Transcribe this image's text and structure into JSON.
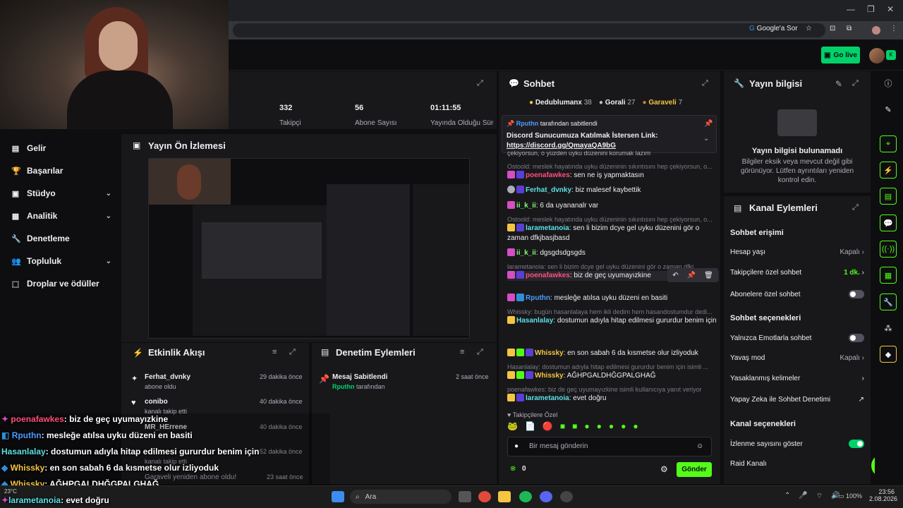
{
  "browser": {
    "google_ask": "Google'a Sor"
  },
  "header": {
    "go_live": "Go live"
  },
  "stats": [
    {
      "value": "332",
      "label": "Takipçi"
    },
    {
      "value": "56",
      "label": "Abone Sayısı"
    },
    {
      "value": "01:11:55",
      "label": "Yayında Olduğu Süre"
    }
  ],
  "nav": [
    {
      "label": "Gelir"
    },
    {
      "label": "Başarılar"
    },
    {
      "label": "Stüdyo"
    },
    {
      "label": "Analitik"
    },
    {
      "label": "Denetleme"
    },
    {
      "label": "Topluluk"
    },
    {
      "label": "Droplar ve ödüller"
    }
  ],
  "preview": {
    "title": "Yayın Ön İzlemesi"
  },
  "activity": {
    "title": "Etkinlik Akışı",
    "items": [
      {
        "name": "Ferhat_dvnky",
        "desc": "abone oldu",
        "time": "29 dakika önce"
      },
      {
        "name": "conibo",
        "desc": "kanalı takip etti",
        "time": "40 dakika önce"
      },
      {
        "name": "MR_HErrene",
        "desc": "",
        "time": "40 dakika önce"
      },
      {
        "name": "",
        "desc": "",
        "time": "52 dakika önce"
      },
      {
        "name": "",
        "desc": "kanalı takip etti",
        "time": ""
      },
      {
        "name": "Garaveli",
        "desc": "Garaveli yeniden abone oldu!",
        "time": "23 saat önce"
      }
    ]
  },
  "mod": {
    "title": "Denetim Eylemleri",
    "items": [
      {
        "action": "Mesaj Sabitlendi",
        "by": "Rputhn",
        "by_suffix": "tarafından",
        "time": "2 saat önce"
      }
    ]
  },
  "chat": {
    "title": "Sohbet",
    "leaders": [
      {
        "name": "Dedublumanx",
        "count": "38"
      },
      {
        "name": "Gorali",
        "count": "27"
      },
      {
        "name": "Garaveli",
        "count": "7"
      }
    ],
    "pinned": {
      "by": "Rputhn",
      "by_suffix": "tarafından sabitlendi",
      "text": "Discord Sunucumuza Katılmak İstersen Link:",
      "link": "https://discord.gg/QmayaQA9bG"
    },
    "partial": "çekiyorsun, o yüzden uyku düzenini korumak lazım",
    "messages": [
      {
        "reply": "Ostoold: meslek hayatında uyku düzeninin sıkıntısını hep çekiyorsun, o...",
        "user": "poenafawkes",
        "color": "#ff4f7b",
        "text": "sen ne iş yapmaktasın"
      },
      {
        "reply": "",
        "user": "Ferhat_dvnky",
        "color": "#5ce1e6",
        "text": "biz malesef kaybettik"
      },
      {
        "reply": "",
        "user": "ii_k_ii",
        "color": "#7cff6b",
        "text": "6 da uyananalr var"
      },
      {
        "reply": "Ostoold: meslek hayatında uyku düzeninin sıkıntısını hep çekiyorsun, o...",
        "user": "larametanoia",
        "color": "#5ce1e6",
        "text": "sen li bizim dcye gel uyku düzenini gör o zaman dfkjbasjbasd"
      },
      {
        "reply": "",
        "user": "ii_k_ii",
        "color": "#7cff6b",
        "text": "dgsgdsdgsgds"
      },
      {
        "reply": "larametanoia: sen li bizim dcye gel uyku düzenini gör o zaman dfkj...",
        "user": "poenafawkes",
        "color": "#ff4f7b",
        "text": "biz de geç uyumayızkine"
      },
      {
        "reply": "",
        "user": "Rputhn",
        "color": "#4f9bff",
        "text": "mesleğe atılsa uyku düzeni en basiti"
      },
      {
        "reply": "Whissky: bugün hasanlalaya hem ikli dedim hem hasandostumdur dedi...",
        "user": "Hasanlalay",
        "color": "#5ce1e6",
        "text": "dostumun adıyla hitap edilmesi gururdur benim için"
      },
      {
        "reply": "",
        "user": "Whissky",
        "color": "#f5c542",
        "text": "en son sabah 6 da kısmetse olur izliyoduk"
      },
      {
        "reply": "Hasanlalay: dostumun adıyla hitap edilmesi gururdur benim için isimli ...",
        "user": "Whissky",
        "color": "#f5c542",
        "text": "AĞHPGALDHĞGPALGHAĞ"
      },
      {
        "reply": "poenafawkes: biz de geç uyumayızkine isimli kullanıcıya yanıt veriyor",
        "user": "larametanoia",
        "color": "#5ce1e6",
        "text": "evet doğru"
      }
    ],
    "followers_only": "Takipçilere Özel",
    "input_placeholder": "Bir mesaj gönderin",
    "points": "0",
    "send": "Gönder"
  },
  "info": {
    "title": "Yayın bilgisi",
    "empty_title": "Yayın bilgisi bulunamadı",
    "empty_desc": "Bilgiler eksik veya mevcut değil gibi görünüyor. Lütfen ayrıntıları yeniden kontrol edin."
  },
  "channel": {
    "title": "Kanal Eylemleri",
    "chat_access": "Sohbet erişimi",
    "account_age": "Hesap yaşı",
    "account_age_val": "Kapalı",
    "followers_chat": "Takipçilere özel sohbet",
    "followers_chat_val": "1 dk.",
    "subs_chat": "Abonelere özel sohbet",
    "chat_options": "Sohbet seçenekleri",
    "emote_only": "Yalnızca Emotlarla sohbet",
    "slow_mode": "Yavaş mod",
    "slow_mode_val": "Kapalı",
    "banned_words": "Yasaklanmış kelimeler",
    "ai_mod": "Yapay Zeka ile Sohbet Denetimi",
    "channel_options": "Kanal seçenekleri",
    "show_viewers": "İzlenme sayısını göster",
    "raid": "Raid Kanalı"
  },
  "overlay": [
    {
      "user": "poenafawkes",
      "color": "#ff4f7b",
      "text": ": biz de geç uyumayızkine"
    },
    {
      "user": "Rputhn",
      "color": "#4f9bff",
      "text": ": mesleğe atılsa uyku düzeni en basiti"
    },
    {
      "user": "Hasanlalay",
      "color": "#5ce1e6",
      "text": ": dostumun adıyla hitap edilmesi gururdur benim için"
    },
    {
      "user": "Whissky",
      "color": "#f5c542",
      "text": ": en son sabah 6 da kısmetse olur izliyoduk"
    },
    {
      "user": "Whissky",
      "color": "#f5c542",
      "text": ": AĞHPGALDHĞGPALGHAĞ"
    },
    {
      "user": "larametanoia",
      "color": "#5ce1e6",
      "text": ": evet doğru"
    }
  ],
  "taskbar": {
    "search": "Ara",
    "weather": "23°C",
    "battery": "100%",
    "time": "23:56",
    "date": "2.08.2026"
  }
}
